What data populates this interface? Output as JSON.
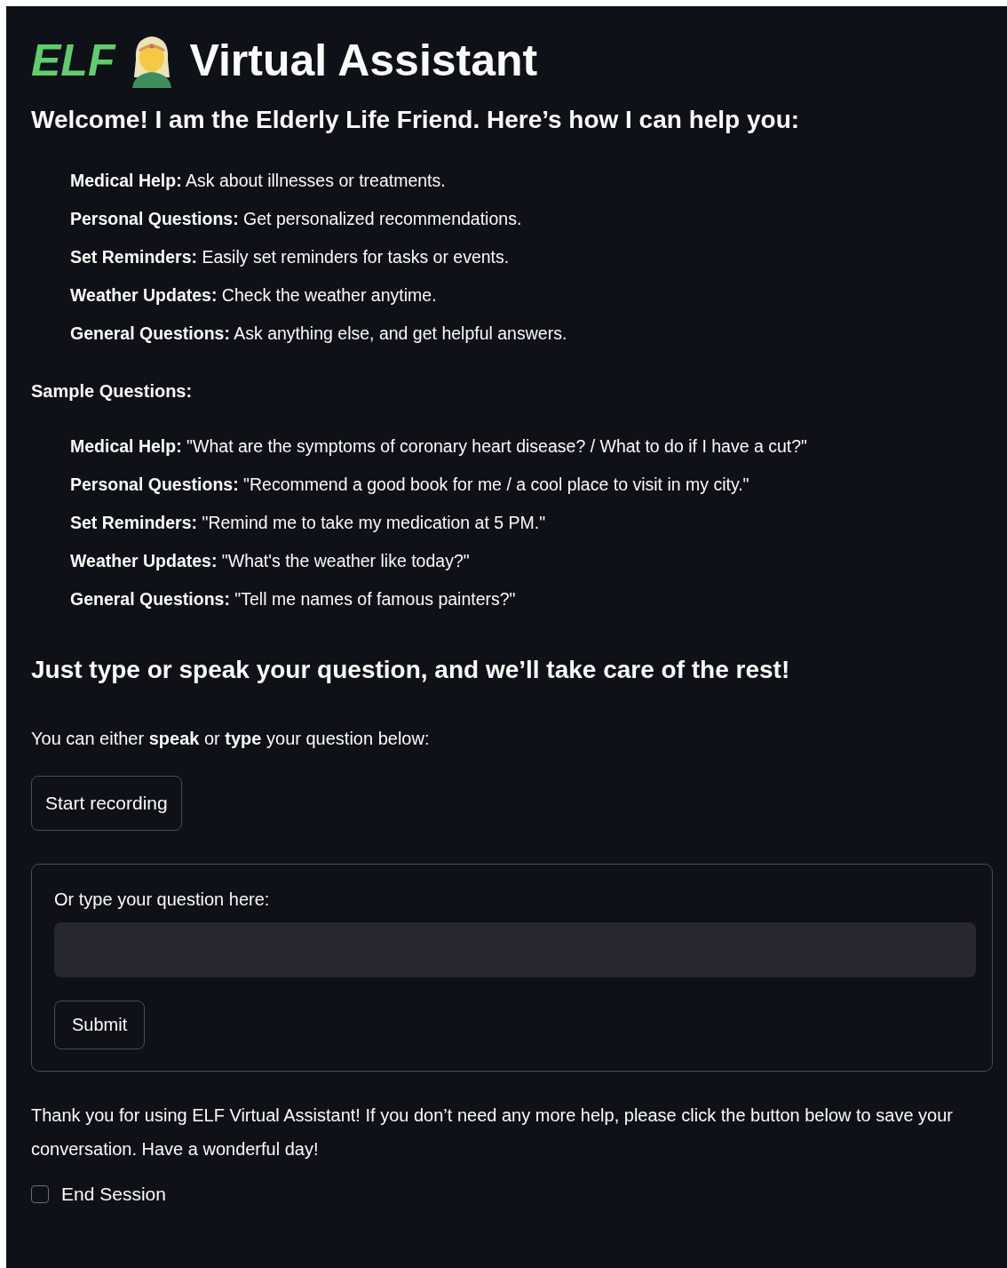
{
  "title": {
    "brand": "ELF",
    "text": "Virtual Assistant"
  },
  "welcome": "Welcome! I am the Elderly Life Friend. Here’s how I can help you:",
  "features": [
    "**Medical Help:** Ask about illnesses or treatments.",
    "**Personal Questions:** Get personalized recommendations.",
    "**Set Reminders:** Easily set reminders for tasks or events.",
    "**Weather Updates:** Check the weather anytime.",
    "**General Questions:** Ask anything else, and get helpful answers."
  ],
  "sample_heading": "Sample Questions:",
  "samples": [
    "**Medical Help:** \"What are the symptoms of coronary heart disease? / What to do if I have a cut?\"",
    "**Personal Questions:** \"Recommend a good book for me / a cool place to visit in my city.\"",
    "**Set Reminders:** \"Remind me to take my medication at 5 PM.\"",
    "**Weather Updates:** \"What's the weather like today?\"",
    "**General Questions:** \"Tell me names of famous painters?\""
  ],
  "closing_heading": "Just type or speak your question, and we’ll take care of the rest!",
  "instruction": "You can either **speak** or **type** your question below:",
  "record_button": "Start recording",
  "form": {
    "label": "Or type your question here:",
    "submit": "Submit"
  },
  "thanks": "Thank you for using ELF Virtual Assistant! If you don’t need any more help, please click the button below to save your conversation. Have a wonderful day!",
  "end_session": {
    "label": "End Session",
    "checked": false
  }
}
